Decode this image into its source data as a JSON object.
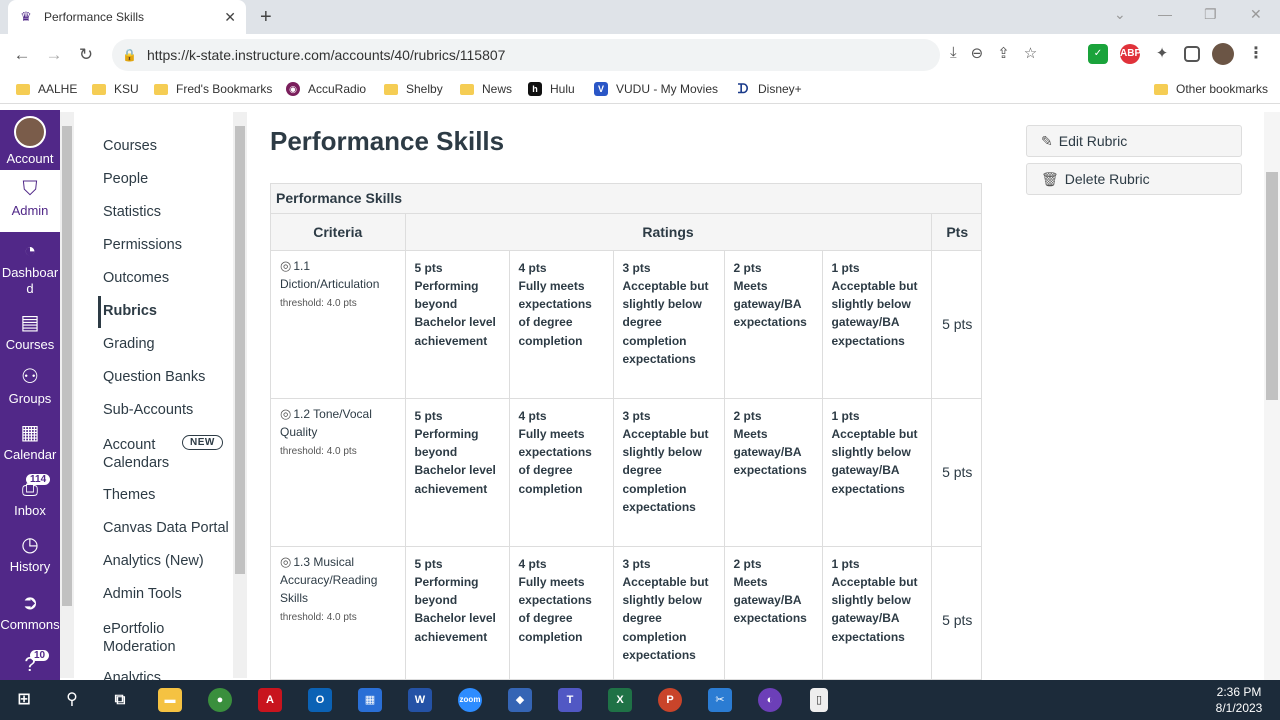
{
  "browser": {
    "tab_title": "Performance Skills",
    "url": "https://k-state.instructure.com/accounts/40/rubrics/115807",
    "bookmarks": [
      {
        "label": "AALHE",
        "type": "folder"
      },
      {
        "label": "KSU",
        "type": "folder"
      },
      {
        "label": "Fred's Bookmarks",
        "type": "folder"
      },
      {
        "label": "AccuRadio",
        "type": "site"
      },
      {
        "label": "Shelby",
        "type": "folder"
      },
      {
        "label": "News",
        "type": "folder"
      },
      {
        "label": "Hulu",
        "type": "site"
      },
      {
        "label": "VUDU - My Movies",
        "type": "site"
      },
      {
        "label": "Disney+",
        "type": "site"
      }
    ],
    "other_bookmarks": "Other bookmarks"
  },
  "global_nav": {
    "account": "Account",
    "admin": "Admin",
    "dashboard_line1": "Dashboar",
    "dashboard_line2": "d",
    "courses": "Courses",
    "groups": "Groups",
    "calendar": "Calendar",
    "inbox": "Inbox",
    "inbox_count": "114",
    "history": "History",
    "commons": "Commons",
    "help_count": "10"
  },
  "course_nav": {
    "items": [
      "Courses",
      "People",
      "Statistics",
      "Permissions",
      "Outcomes",
      "Rubrics",
      "Grading",
      "Question Banks",
      "Sub-Accounts"
    ],
    "account_calendars_1": "Account",
    "account_calendars_2": "Calendars",
    "new_badge": "NEW",
    "items2": [
      "Themes",
      "Canvas Data Portal",
      "Analytics (New)",
      "Admin Tools"
    ],
    "eportfolio_1": "ePortfolio",
    "eportfolio_2": "Moderation",
    "cut_item": "Analytics"
  },
  "main": {
    "title": "Performance Skills",
    "edit_rubric": "Edit Rubric",
    "delete_rubric": "Delete Rubric"
  },
  "rubric": {
    "title": "Performance Skills",
    "headers": {
      "criteria": "Criteria",
      "ratings": "Ratings",
      "pts": "Pts"
    },
    "rows": [
      {
        "criterion": "1.1 Diction/Articulation",
        "threshold": "threshold: 4.0 pts",
        "ratings": [
          {
            "pts": "5 pts",
            "desc": "Performing beyond Bachelor level achievement"
          },
          {
            "pts": "4 pts",
            "desc": "Fully meets expectations of degree completion"
          },
          {
            "pts": "3 pts",
            "desc": "Acceptable but slightly below degree completion expectations"
          },
          {
            "pts": "2 pts",
            "desc": "Meets gateway/BA expectations"
          },
          {
            "pts": "1 pts",
            "desc": "Acceptable but slightly below gateway/BA expectations"
          }
        ],
        "total": "5 pts"
      },
      {
        "criterion": "1.2 Tone/Vocal Quality",
        "threshold": "threshold: 4.0 pts",
        "ratings": [
          {
            "pts": "5 pts",
            "desc": "Performing beyond Bachelor level achievement"
          },
          {
            "pts": "4 pts",
            "desc": "Fully meets expectations of degree completion"
          },
          {
            "pts": "3 pts",
            "desc": "Acceptable but slightly below degree completion expectations"
          },
          {
            "pts": "2 pts",
            "desc": "Meets gateway/BA expectations"
          },
          {
            "pts": "1 pts",
            "desc": "Acceptable but slightly below gateway/BA expectations"
          }
        ],
        "total": "5 pts"
      },
      {
        "criterion": "1.3 Musical Accuracy/Reading Skills",
        "threshold": "threshold: 4.0 pts",
        "ratings": [
          {
            "pts": "5 pts",
            "desc": "Performing beyond Bachelor level achievement"
          },
          {
            "pts": "4 pts",
            "desc": "Fully meets expectations of degree completion"
          },
          {
            "pts": "3 pts",
            "desc": "Acceptable but slightly below degree completion expectations"
          },
          {
            "pts": "2 pts",
            "desc": "Meets gateway/BA expectations"
          },
          {
            "pts": "1 pts",
            "desc": "Acceptable but slightly below gateway/BA expectations"
          }
        ],
        "total": "5 pts"
      }
    ]
  },
  "taskbar": {
    "time": "2:36 PM",
    "date": "8/1/2023"
  },
  "colors": {
    "canvas_purple": "#512888",
    "text": "#2d3b45"
  }
}
